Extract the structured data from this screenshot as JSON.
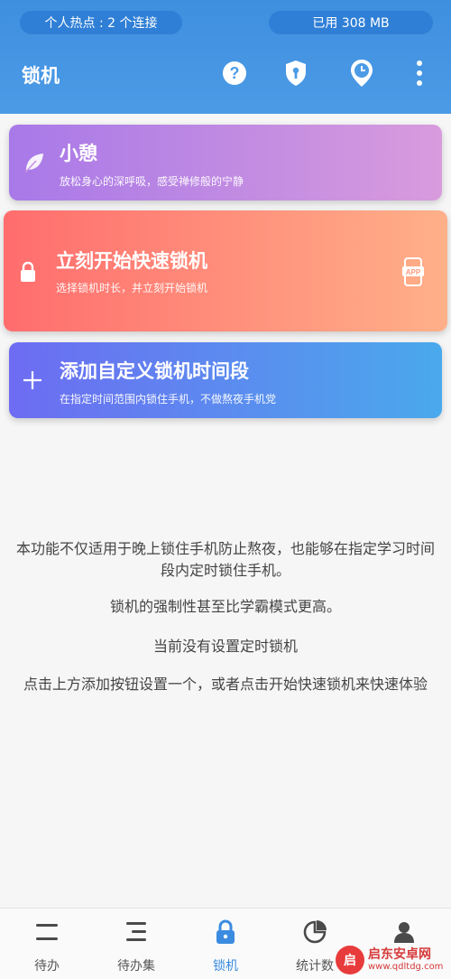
{
  "status_bar": {
    "hotspot": "个人热点 : 2 个连接",
    "memory": "已用 308 MB"
  },
  "header": {
    "title": "锁机",
    "icons": [
      "help-icon",
      "shield-icon",
      "clock-pin-icon",
      "more-vertical-icon"
    ]
  },
  "cards": {
    "rest": {
      "title": "小憩",
      "subtitle": "放松身心的深呼吸，感受禅修般的宁静",
      "icon": "leaf-icon"
    },
    "quick": {
      "title": "立刻开始快速锁机",
      "subtitle": "选择锁机时长，并立刻开始锁机",
      "icon": "lock-icon",
      "right_icon": "app-icon",
      "right_icon_text": "APP"
    },
    "add": {
      "title": "添加自定义锁机时间段",
      "subtitle": "在指定时间范围内锁住手机，不做熬夜手机党",
      "icon": "plus-icon"
    }
  },
  "info": {
    "p1": "本功能不仅适用于晚上锁住手机防止熬夜，也能够在指定学习时间段内定时锁住手机。",
    "p2": "锁机的强制性甚至比学霸模式更高。",
    "p3": "当前没有设置定时锁机",
    "p4": "点击上方添加按钮设置一个，或者点击开始快速锁机来快速体验"
  },
  "nav": {
    "items": [
      {
        "label": "待办",
        "icon": "todo-icon"
      },
      {
        "label": "待办集",
        "icon": "todo-set-icon"
      },
      {
        "label": "锁机",
        "icon": "lock-icon",
        "active": true
      },
      {
        "label": "统计数",
        "icon": "pie-chart-icon"
      },
      {
        "label": "",
        "icon": "user-icon"
      }
    ]
  },
  "watermark": {
    "name": "启东安卓网",
    "url": "www.qdltdg.com",
    "logo": "启"
  },
  "colors": {
    "header": "#4b9be6",
    "accent": "#3b8ce0"
  }
}
